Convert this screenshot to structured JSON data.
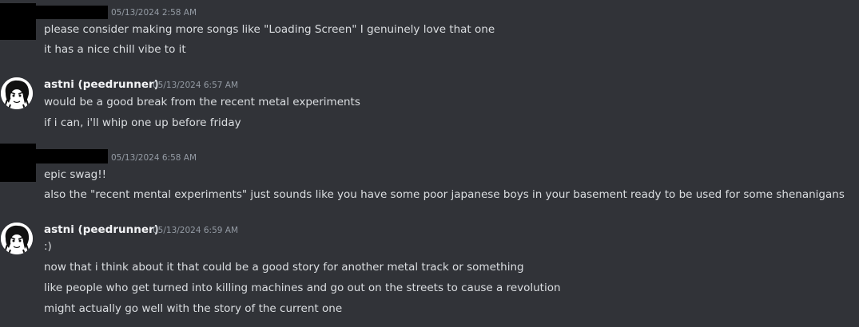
{
  "messages": [
    {
      "author": "",
      "timestamp": "05/13/2024 2:58 AM",
      "lines": [
        "please consider making more songs like \"Loading Screen\" I genuinely love that one",
        "it has a nice chill vibe to it"
      ]
    },
    {
      "author": "astni (peedrunner)",
      "timestamp": "05/13/2024 6:57 AM",
      "lines": [
        "would be a good break from the recent metal experiments",
        "if i can, i'll whip one up before friday"
      ]
    },
    {
      "author": "",
      "timestamp": "05/13/2024 6:58 AM",
      "lines": [
        "epic swag!!",
        "also the \"recent mental experiments\" just sounds like you have some poor japanese boys in your basement ready to be used for some shenanigans"
      ]
    },
    {
      "author": "astni (peedrunner)",
      "timestamp": "05/13/2024 6:59 AM",
      "lines": [
        ":)",
        "now that i think about it that could be a good story for another metal track or something",
        "like people who get turned into killing machines and go out on the streets to cause a revolution",
        "might actually go well with the story of the current one"
      ]
    }
  ]
}
